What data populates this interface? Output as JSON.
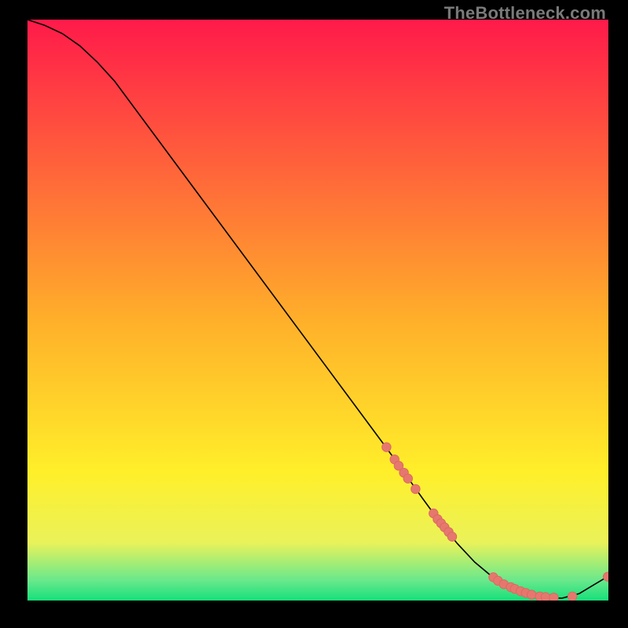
{
  "watermark": "TheBottleneck.com",
  "colors": {
    "bg": "#000000",
    "watermark": "#7a7a7a",
    "curve": "#000000",
    "point_fill": "#e6776f",
    "point_stroke": "#d9675f",
    "grad_top": "#ff1a4a",
    "grad_yellow": "#ffef2a",
    "grad_green": "#16e07a"
  },
  "chart_data": {
    "type": "line",
    "title": "",
    "xlabel": "",
    "ylabel": "",
    "xlim": [
      0,
      100
    ],
    "ylim": [
      0,
      100
    ],
    "curve": [
      {
        "x": 0,
        "y": 100
      },
      {
        "x": 3,
        "y": 99
      },
      {
        "x": 6,
        "y": 97.6
      },
      {
        "x": 9,
        "y": 95.5
      },
      {
        "x": 12,
        "y": 92.7
      },
      {
        "x": 15,
        "y": 89.4
      },
      {
        "x": 62,
        "y": 26.0
      },
      {
        "x": 65,
        "y": 21.8
      },
      {
        "x": 68,
        "y": 17.6
      },
      {
        "x": 71,
        "y": 13.5
      },
      {
        "x": 74,
        "y": 9.8
      },
      {
        "x": 77,
        "y": 6.6
      },
      {
        "x": 80,
        "y": 4.1
      },
      {
        "x": 83,
        "y": 2.4
      },
      {
        "x": 86,
        "y": 1.2
      },
      {
        "x": 89,
        "y": 0.5
      },
      {
        "x": 92,
        "y": 0.4
      },
      {
        "x": 95,
        "y": 1.2
      },
      {
        "x": 97,
        "y": 2.4
      },
      {
        "x": 100,
        "y": 4.2
      }
    ],
    "points": [
      {
        "x": 61.8,
        "y": 26.4
      },
      {
        "x": 63.2,
        "y": 24.3
      },
      {
        "x": 63.9,
        "y": 23.2
      },
      {
        "x": 64.8,
        "y": 22.0
      },
      {
        "x": 65.5,
        "y": 21.0
      },
      {
        "x": 66.8,
        "y": 19.2
      },
      {
        "x": 69.9,
        "y": 15.0
      },
      {
        "x": 70.6,
        "y": 14.0
      },
      {
        "x": 71.2,
        "y": 13.3
      },
      {
        "x": 71.8,
        "y": 12.6
      },
      {
        "x": 72.5,
        "y": 11.8
      },
      {
        "x": 73.1,
        "y": 11.0
      },
      {
        "x": 80.2,
        "y": 4.0
      },
      {
        "x": 81.0,
        "y": 3.4
      },
      {
        "x": 82.0,
        "y": 2.8
      },
      {
        "x": 83.2,
        "y": 2.3
      },
      {
        "x": 83.9,
        "y": 2.0
      },
      {
        "x": 84.9,
        "y": 1.6
      },
      {
        "x": 85.8,
        "y": 1.3
      },
      {
        "x": 86.8,
        "y": 1.0
      },
      {
        "x": 88.2,
        "y": 0.7
      },
      {
        "x": 89.2,
        "y": 0.6
      },
      {
        "x": 90.6,
        "y": 0.5
      },
      {
        "x": 93.8,
        "y": 0.7
      },
      {
        "x": 99.9,
        "y": 4.1
      }
    ]
  }
}
